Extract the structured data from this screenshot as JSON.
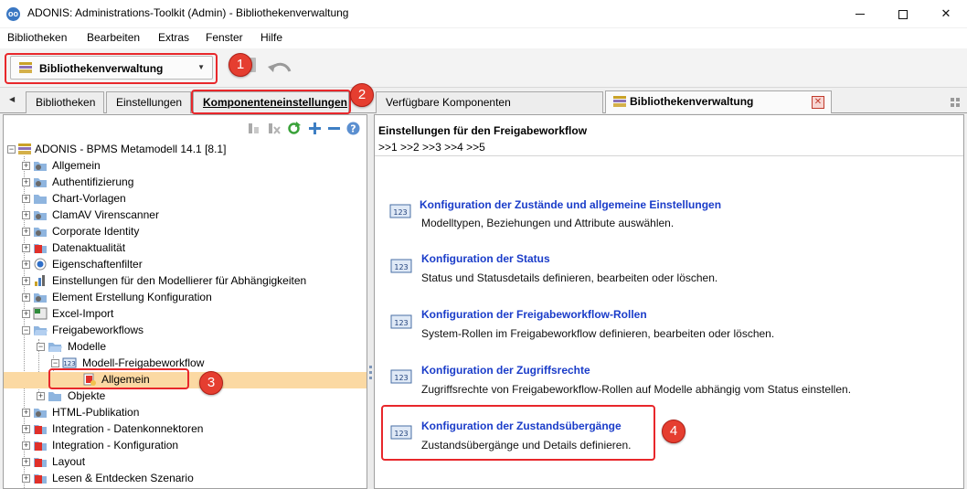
{
  "window": {
    "title": "ADONIS: Administrations-Toolkit (Admin) - Bibliothekenverwaltung",
    "close_glyph": "✕"
  },
  "menu": [
    {
      "label": "Bibliotheken"
    },
    {
      "label": "Bearbeiten"
    },
    {
      "label": "Extras"
    },
    {
      "label": "Fenster"
    },
    {
      "label": "Hilfe"
    }
  ],
  "toolbar": {
    "combo_value": "Bibliothekenverwaltung"
  },
  "tabs": [
    {
      "label": "Bibliotheken"
    },
    {
      "label": "Einstellungen"
    },
    {
      "label": "Komponenteneinstellungen"
    },
    {
      "label": "Verfügbare Komponenten"
    },
    {
      "label": "Bibliothekenverwaltung"
    }
  ],
  "tree": [
    {
      "label": "ADONIS - BPMS Metamodell 14.1 [8.1]",
      "icon": "library-icon",
      "expander": "−"
    },
    {
      "label": "Allgemein",
      "icon": "gear-folder-icon",
      "expander": "+"
    },
    {
      "label": "Authentifizierung",
      "icon": "gear-folder-icon",
      "expander": "+"
    },
    {
      "label": "Chart-Vorlagen",
      "icon": "folder-icon",
      "expander": "+"
    },
    {
      "label": "ClamAV Virenscanner",
      "icon": "gear-folder-icon",
      "expander": "+"
    },
    {
      "label": "Corporate Identity",
      "icon": "gear-folder-icon",
      "expander": "+"
    },
    {
      "label": "Datenaktualität",
      "icon": "red-folder-icon",
      "expander": "+"
    },
    {
      "label": "Eigenschaftenfilter",
      "icon": "radio-icon",
      "expander": "+"
    },
    {
      "label": "Einstellungen für den Modellierer für Abhängigkeiten",
      "icon": "chart-icon",
      "expander": "+"
    },
    {
      "label": "Element Erstellung Konfiguration",
      "icon": "gear-folder-icon",
      "expander": "+"
    },
    {
      "label": "Excel-Import",
      "icon": "excel-icon",
      "expander": "+"
    },
    {
      "label": "Freigabeworkflows",
      "icon": "open-folder-icon",
      "expander": "−"
    },
    {
      "label": "Modelle",
      "icon": "open-folder-icon",
      "expander": "−"
    },
    {
      "label": "Modell-Freigabeworkflow",
      "icon": "workflow-icon",
      "expander": "−"
    },
    {
      "label": "Allgemein",
      "icon": "red-doc-icon",
      "expander": ""
    },
    {
      "label": "Objekte",
      "icon": "folder-icon",
      "expander": "+"
    },
    {
      "label": "HTML-Publikation",
      "icon": "gear-folder-icon",
      "expander": "+"
    },
    {
      "label": "Integration - Datenkonnektoren",
      "icon": "red-folder-icon",
      "expander": "+"
    },
    {
      "label": "Integration - Konfiguration",
      "icon": "red-folder-icon",
      "expander": "+"
    },
    {
      "label": "Layout",
      "icon": "red-folder-icon",
      "expander": "+"
    },
    {
      "label": "Lesen & Entdecken Szenario",
      "icon": "red-folder-icon",
      "expander": "+"
    }
  ],
  "right": {
    "title": "Einstellungen für den Freigabeworkflow",
    "steps": ">>1 >>2 >>3 >>4 >>5",
    "items": [
      {
        "link": "Konfiguration der Zustände und allgemeine Einstellungen",
        "desc": "Modelltypen, Beziehungen und Attribute auswählen."
      },
      {
        "link": "Konfiguration der Status",
        "desc": "Status und Statusdetails definieren, bearbeiten oder löschen."
      },
      {
        "link": "Konfiguration der Freigabeworkflow-Rollen",
        "desc": "System-Rollen im Freigabeworkflow definieren, bearbeiten oder löschen."
      },
      {
        "link": "Konfiguration der Zugriffsrechte",
        "desc": "Zugriffsrechte von Freigabeworkflow-Rollen auf Modelle abhängig vom Status einstellen."
      },
      {
        "link": "Konfiguration der Zustandsübergänge",
        "desc": "Zustandsübergänge und Details definieren."
      }
    ]
  },
  "annotations": [
    "1",
    "2",
    "3",
    "4"
  ],
  "colors": {
    "highlight": "#e8272b",
    "badge": "#e53e30",
    "link": "#1a3cc9",
    "selection": "#fbd9a3"
  }
}
